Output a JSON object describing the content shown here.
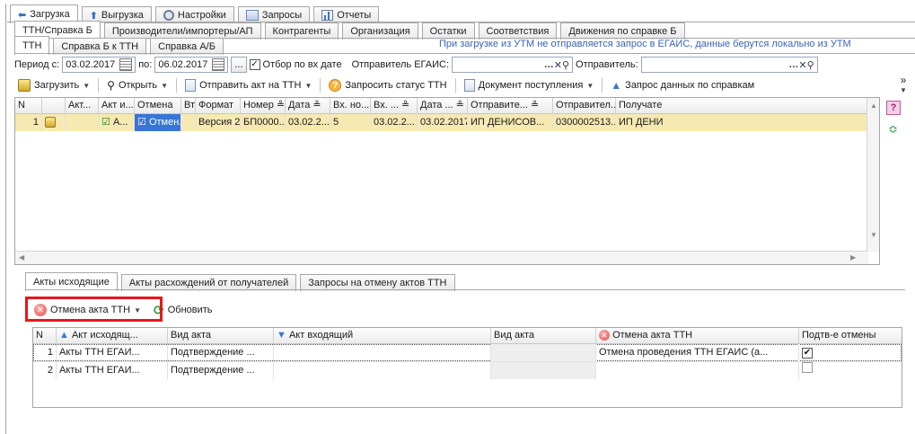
{
  "top_tabs": [
    {
      "label": "Загрузка",
      "icon": "download-icon",
      "active": true
    },
    {
      "label": "Выгрузка",
      "icon": "upload-icon",
      "active": false
    },
    {
      "label": "Настройки",
      "icon": "gear-icon",
      "active": false
    },
    {
      "label": "Запросы",
      "icon": "query-icon",
      "active": false
    },
    {
      "label": "Отчеты",
      "icon": "report-icon",
      "active": false
    }
  ],
  "second_tabs": [
    {
      "label": "ТТН/Справка Б",
      "active": true
    },
    {
      "label": "Производители/импортеры/АП",
      "active": false
    },
    {
      "label": "Контрагенты",
      "active": false
    },
    {
      "label": "Организация",
      "active": false
    },
    {
      "label": "Остатки",
      "active": false
    },
    {
      "label": "Соответствия",
      "active": false
    },
    {
      "label": "Движения по справке Б",
      "active": false
    }
  ],
  "third_tabs": [
    {
      "label": "ТТН",
      "active": true
    },
    {
      "label": "Справка Б к ТТН",
      "active": false
    },
    {
      "label": "Справка А/Б",
      "active": false
    }
  ],
  "notice": "При загрузке из УТМ не отправляется запрос в ЕГАИС, данные берутся локально из УТМ",
  "filter": {
    "period_label": "Период с:",
    "date_from": "03.02.2017",
    "to_label": "по:",
    "date_to": "06.02.2017",
    "ellipsis": "...",
    "filter_by_date_label": "Отбор по вх дате",
    "filter_by_date_checked": true,
    "sender_egais_label": "Отправитель ЕГАИС:",
    "sender_egais_value": "",
    "sender_label": "Отправитель:",
    "sender_value": ""
  },
  "toolbar": {
    "load": "Загрузить",
    "open": "Открыть",
    "send_act": "Отправить акт на ТТН",
    "request_status": "Запросить статус ТТН",
    "receipt_doc": "Документ поступления",
    "request_data": "Запрос данных по справкам",
    "more": "»"
  },
  "main_grid": {
    "headers": [
      "N",
      "",
      "Акт...",
      "Акт и...",
      "Отмена",
      "Вт",
      "Формат",
      "Номер ≗",
      "Дата ≗",
      "Вх. но...",
      "Вх. ... ≗",
      "Дата ... ≗",
      "Отправите... ≗",
      "Отправител...",
      "Получате"
    ],
    "rows": [
      [
        "1",
        "",
        "",
        "А...",
        "Отмен...",
        "",
        "Версия 2",
        "БП0000...",
        "03.02.2...",
        "5",
        "03.02.2...",
        "03.02.2017",
        "ИП ДЕНИСОВ...",
        "0300002513...",
        "ИП ДЕНИ"
      ]
    ]
  },
  "help_icon": "?",
  "bottom_tabs": [
    {
      "label": "Акты исходящие",
      "active": true
    },
    {
      "label": "Акты расхождений от получателей",
      "active": false
    },
    {
      "label": "Запросы на отмену актов ТТН",
      "active": false
    }
  ],
  "bottom_toolbar": {
    "cancel_act": "Отмена акта ТТН",
    "refresh": "Обновить"
  },
  "acts_grid": {
    "headers": [
      "N",
      "Акт исходящ...",
      "Вид акта",
      "Акт входящий",
      "Вид акта",
      "Отмена акта ТТН",
      "Подтв-е отмены"
    ],
    "rows": [
      {
        "n": "1",
        "out": "Акты ТТН ЕГАИ...",
        "kind": "Подтверждение ...",
        "in": "",
        "kind2": "",
        "cancel": "Отмена проведения ТТН ЕГАИС (а...",
        "confirmed": true
      },
      {
        "n": "2",
        "out": "Акты ТТН ЕГАИ...",
        "kind": "Подтверждение ...",
        "in": "",
        "kind2": "",
        "cancel": "",
        "confirmed": false
      }
    ]
  },
  "colors": {
    "accent_blue": "#3875d7",
    "selection_yellow": "#f6e9b2",
    "notice_blue": "#3b63b6",
    "highlight_red": "#e8161d"
  }
}
